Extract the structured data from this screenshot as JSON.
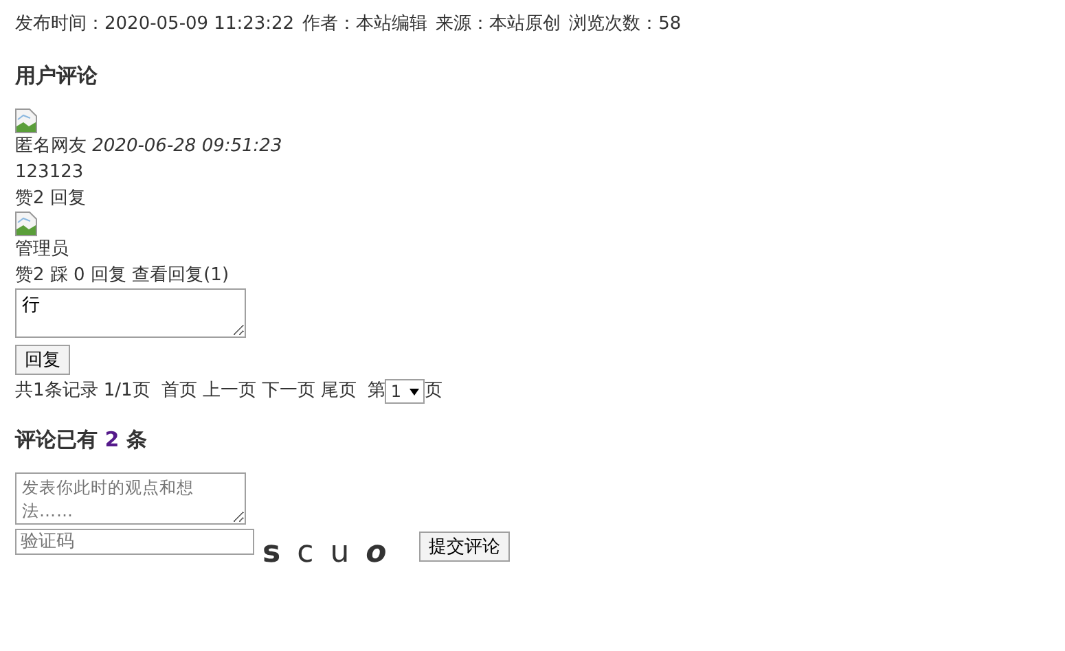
{
  "meta": {
    "items": [
      "发布时间：2020-05-09 11:23:22",
      "作者：本站编辑",
      "来源：本站原创",
      "浏览次数：58"
    ]
  },
  "comments_heading": "用户评论",
  "comment": {
    "author": "匿名网友",
    "time": "2020-06-28 09:51:23",
    "text": "123123",
    "like": "赞2",
    "reply": "回复"
  },
  "reply_item": {
    "author": "管理员",
    "like": "赞2",
    "dislike": "踩 0",
    "reply": "回复",
    "view_replies": "查看回复(1)",
    "reply_box_value": "行",
    "reply_button": "回复"
  },
  "pager": {
    "summary": "共1条记录 1/1页",
    "links": [
      "首页",
      "上一页",
      "下一页",
      "尾页"
    ],
    "page_prefix": "第",
    "page_value": "1",
    "page_suffix": "页"
  },
  "count_heading": {
    "prefix": "评论已有",
    "count": "2",
    "suffix": "条"
  },
  "form": {
    "comment_placeholder": "发表你此时的观点和想法……",
    "captcha_placeholder": "验证码",
    "captcha": [
      "s",
      "c",
      "u",
      "o"
    ],
    "submit": "提交评论"
  }
}
